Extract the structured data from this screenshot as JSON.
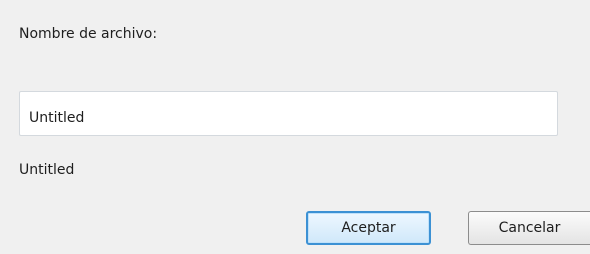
{
  "dialog": {
    "filename_label": "Nombre de archivo:",
    "filename_value": "Untitled",
    "preview_text": "Untitled",
    "ok_label": "Aceptar",
    "cancel_label": "Cancelar"
  },
  "colors": {
    "background": "#f0f0f0",
    "field_background": "#ffffff",
    "field_border": "#d4d9de",
    "default_button_border": "#3c91d4",
    "button_border": "#8c8c8c"
  }
}
